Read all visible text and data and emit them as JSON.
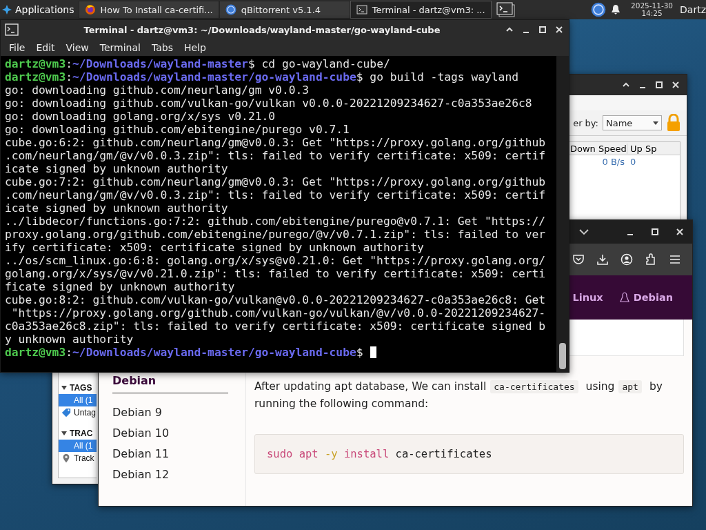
{
  "taskbar": {
    "apps_menu": "Applications",
    "tasks": [
      {
        "kind": "firefox",
        "title": "How To Install ca-certifi...",
        "selected": false
      },
      {
        "kind": "qbittorrent",
        "title": "qBittorrent v5.1.4",
        "selected": false
      },
      {
        "kind": "terminal",
        "title": "Terminal - dartz@vm3: ...",
        "selected": true
      }
    ],
    "date": "2025-11-30",
    "time": "14:25",
    "user": "Dartz"
  },
  "qbittorrent": {
    "filter_label": "er by:",
    "sort": "Name",
    "columns": [
      "Down Speed",
      "Up Sp"
    ],
    "rows": [
      [
        "0 B/s",
        "0"
      ]
    ],
    "sidebar": [
      {
        "title": "TAGS",
        "items": [
          {
            "kind": "all",
            "label": "All (1",
            "selected": true
          },
          {
            "kind": "tag",
            "label": "Untag",
            "selected": false
          }
        ]
      },
      {
        "title": "TRAC",
        "items": [
          {
            "kind": "all",
            "label": "All (1",
            "selected": true
          },
          {
            "kind": "tracker",
            "label": "Track",
            "selected": false
          }
        ]
      }
    ]
  },
  "firefox": {
    "nav": [
      {
        "kind": "text",
        "label": "Linux"
      },
      {
        "kind": "tux",
        "label": "Debian"
      }
    ],
    "sidebar": {
      "heading": "Debian",
      "items": [
        "Debian 9",
        "Debian 10",
        "Debian 11",
        "Debian 12"
      ]
    },
    "paragraph": [
      {
        "kind": "text",
        "text": "After updating apt database, We can install"
      },
      {
        "kind": "code",
        "text": "ca-certificates"
      },
      {
        "kind": "text",
        "text": "using"
      },
      {
        "kind": "code",
        "text": "apt"
      },
      {
        "kind": "text",
        "text": "by running the following command:"
      }
    ],
    "code": [
      {
        "kind": "command",
        "text": "sudo apt"
      },
      {
        "kind": "flag",
        "text": "-y"
      },
      {
        "kind": "command",
        "text": "install"
      },
      {
        "kind": "argument",
        "text": "ca-certificates"
      }
    ]
  },
  "terminal": {
    "title": "Terminal - dartz@vm3: ~/Downloads/wayland-master/go-wayland-cube",
    "menu": [
      "File",
      "Edit",
      "View",
      "Terminal",
      "Tabs",
      "Help"
    ],
    "lines": [
      {
        "kind": "prompt",
        "user": "dartz@vm3",
        "separator": ":",
        "path": "~/Downloads/wayland-master",
        "command": "$ cd go-wayland-cube/"
      },
      {
        "kind": "prompt",
        "user": "dartz@vm3",
        "separator": ":",
        "path": "~/Downloads/wayland-master/go-wayland-cube",
        "command": "$ go build -tags wayland"
      },
      {
        "kind": "output",
        "text": "go: downloading github.com/neurlang/gm v0.0.3"
      },
      {
        "kind": "output",
        "text": "go: downloading github.com/vulkan-go/vulkan v0.0.0-20221209234627-c0a353ae26c8"
      },
      {
        "kind": "output",
        "text": "go: downloading golang.org/x/sys v0.21.0"
      },
      {
        "kind": "output",
        "text": "go: downloading github.com/ebitengine/purego v0.7.1"
      },
      {
        "kind": "output",
        "text": "cube.go:6:2: github.com/neurlang/gm@v0.0.3: Get \"https://proxy.golang.org/github"
      },
      {
        "kind": "output",
        "text": ".com/neurlang/gm/@v/v0.0.3.zip\": tls: failed to verify certificate: x509: certif"
      },
      {
        "kind": "output",
        "text": "icate signed by unknown authority"
      },
      {
        "kind": "output",
        "text": "cube.go:7:2: github.com/neurlang/gm@v0.0.3: Get \"https://proxy.golang.org/github"
      },
      {
        "kind": "output",
        "text": ".com/neurlang/gm/@v/v0.0.3.zip\": tls: failed to verify certificate: x509: certif"
      },
      {
        "kind": "output",
        "text": "icate signed by unknown authority"
      },
      {
        "kind": "output",
        "text": "../libdecor/functions.go:7:2: github.com/ebitengine/purego@v0.7.1: Get \"https://"
      },
      {
        "kind": "output",
        "text": "proxy.golang.org/github.com/ebitengine/purego/@v/v0.7.1.zip\": tls: failed to ver"
      },
      {
        "kind": "output",
        "text": "ify certificate: x509: certificate signed by unknown authority"
      },
      {
        "kind": "output",
        "text": "../os/scm_linux.go:6:8: golang.org/x/sys@v0.21.0: Get \"https://proxy.golang.org/"
      },
      {
        "kind": "output",
        "text": "golang.org/x/sys/@v/v0.21.0.zip\": tls: failed to verify certificate: x509: certi"
      },
      {
        "kind": "output",
        "text": "ficate signed by unknown authority"
      },
      {
        "kind": "output",
        "text": "cube.go:8:2: github.com/vulkan-go/vulkan@v0.0.0-20221209234627-c0a353ae26c8: Get"
      },
      {
        "kind": "output",
        "text": " \"https://proxy.golang.org/github.com/vulkan-go/vulkan/@v/v0.0.0-20221209234627-"
      },
      {
        "kind": "output",
        "text": "c0a353ae26c8.zip\": tls: failed to verify certificate: x509: certificate signed b"
      },
      {
        "kind": "output",
        "text": "y unknown authority"
      },
      {
        "kind": "prompt",
        "user": "dartz@vm3",
        "separator": ":",
        "path": "~/Downloads/wayland-master/go-wayland-cube",
        "command": "$",
        "cursor": true
      }
    ]
  }
}
